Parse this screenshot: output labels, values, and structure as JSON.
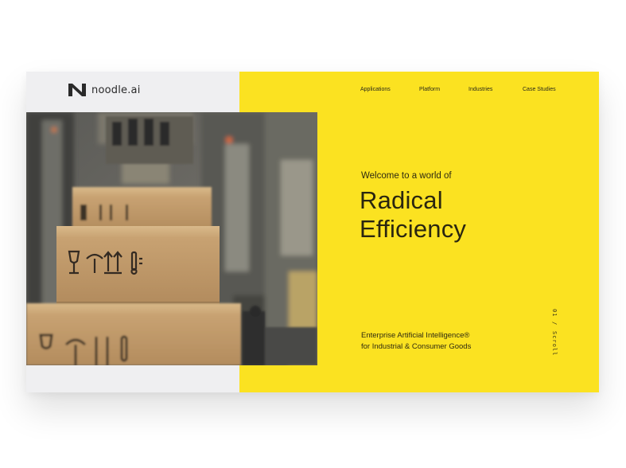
{
  "brand": {
    "name": "noodle.ai",
    "mark_icon": "noodle-n-logo-icon"
  },
  "nav": {
    "items": [
      {
        "label": "Applications"
      },
      {
        "label": "Platform"
      },
      {
        "label": "Industries"
      },
      {
        "label": "Case Studies"
      }
    ]
  },
  "hero": {
    "welcome": "Welcome to a world of",
    "headline_line1": "Radical",
    "headline_line2": "Efficiency",
    "tagline_line1": "Enterprise Artificial Intelligence®",
    "tagline_line2": "for Industrial & Consumer Goods",
    "image_alt_icon": "conveyor-boxes-image"
  },
  "scroll": {
    "index": "01",
    "separator": "/",
    "label": "Scroll"
  },
  "colors": {
    "accent_yellow": "#fbe221",
    "panel_gray": "#efeff1",
    "text_dark": "#2a2610"
  }
}
